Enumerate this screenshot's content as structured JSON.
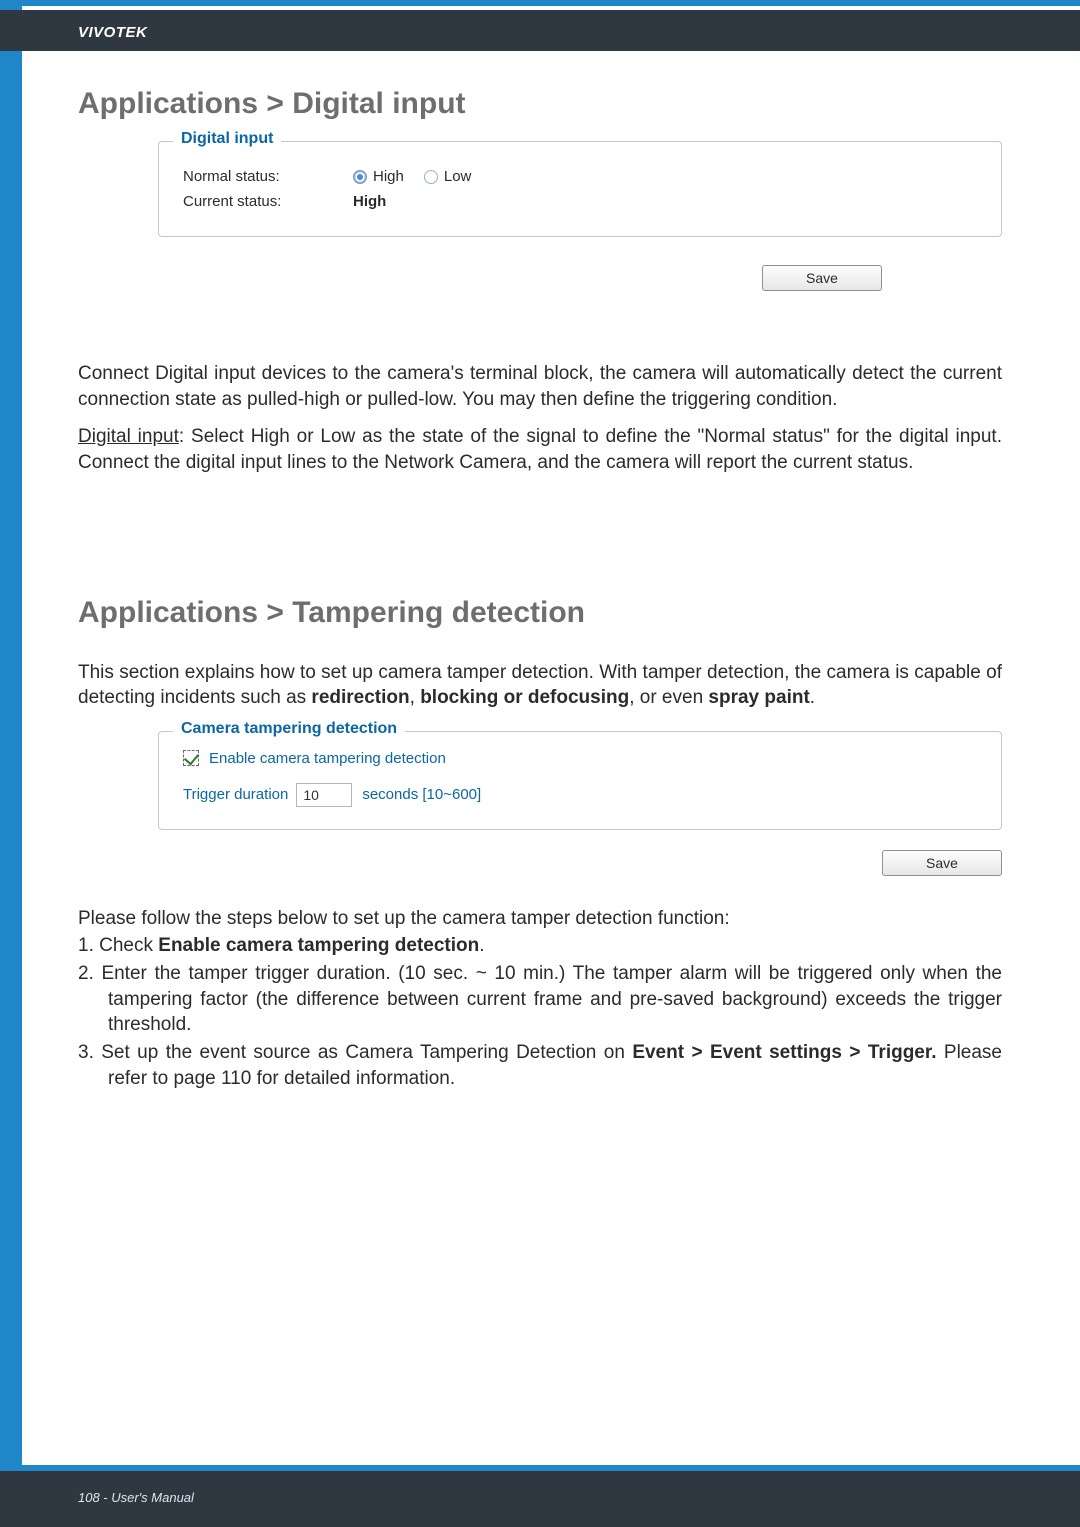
{
  "header": {
    "brand": "VIVOTEK"
  },
  "section1": {
    "title": "Applications > Digital input",
    "fieldset_legend": "Digital input",
    "row_normal_label": "Normal status:",
    "radio_high": "High",
    "radio_low": "Low",
    "row_current_label": "Current status:",
    "current_value": "High",
    "save_label": "Save"
  },
  "para1": "Connect Digital input devices to the camera's terminal block, the camera will automatically detect the current connection state as pulled-high or pulled-low. You may then define the triggering condition.",
  "para2a": "Digital input",
  "para2b": ": Select High or Low as the state of the signal to define the \"Normal status\" for the digital input. Connect the digital input lines to the Network Camera, and the camera will report the current status.",
  "section2": {
    "title": "Applications > Tampering detection",
    "intro_a": "This section explains how to set up camera tamper detection. With tamper detection, the camera is capable of detecting incidents such as ",
    "intro_bold1": "redirection",
    "intro_sep1": ", ",
    "intro_bold2": "blocking or defocusing",
    "intro_sep2": ", or even ",
    "intro_bold3": "spray paint",
    "intro_end": ".",
    "fieldset_legend": "Camera tampering detection",
    "enable_label": "Enable camera tampering detection",
    "trigger_label": "Trigger duration",
    "trigger_value": "10",
    "trigger_suffix": "seconds [10~600]",
    "save_label": "Save"
  },
  "steps": {
    "lead": "Please follow the steps below to set up the camera tamper detection function:",
    "s1a": "1. Check ",
    "s1b": "Enable camera tampering detection",
    "s1c": ".",
    "s2": "2. Enter the tamper trigger duration. (10 sec. ~ 10 min.) The tamper alarm will be triggered only when the tampering factor (the difference between current frame and pre-saved background) exceeds the trigger threshold.",
    "s3a": "3. Set up the event source as Camera Tampering Detection on ",
    "s3b": "Event > Event settings > Trigger.",
    "s3c": " Please refer to page 110 for detailed information."
  },
  "footer": {
    "page": "108 - User's Manual"
  }
}
